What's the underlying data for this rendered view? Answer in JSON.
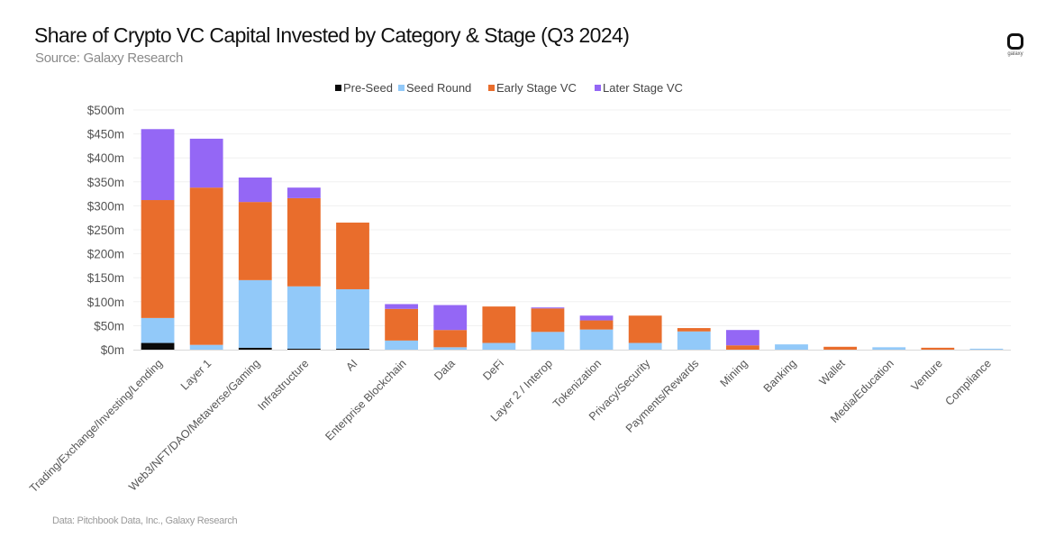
{
  "header": {
    "title": "Share of Crypto VC Capital Invested by Category & Stage (Q3 2024)",
    "subtitle": "Source: Galaxy Research",
    "logo_text": "galaxy",
    "logo_icon": "galaxy-logo-icon"
  },
  "footer": {
    "source_note": "Data: Pitchbook Data, Inc., Galaxy Research"
  },
  "chart_data": {
    "type": "bar",
    "stacked": true,
    "title": "Share of Crypto VC Capital Invested by Category & Stage (Q3 2024)",
    "xlabel": "",
    "ylabel": "",
    "ylim": [
      0,
      500
    ],
    "yticks": [
      0,
      50,
      100,
      150,
      200,
      250,
      300,
      350,
      400,
      450,
      500
    ],
    "ytick_labels": [
      "$0m",
      "$50m",
      "$100m",
      "$150m",
      "$200m",
      "$250m",
      "$300m",
      "$350m",
      "$400m",
      "$450m",
      "$500m"
    ],
    "grid": true,
    "legend_position": "top-center",
    "categories": [
      "Trading/Exchange/Investing/Lending",
      "Layer 1",
      "Web3/NFT/DAO/Metaverse/Gaming",
      "Infrastructure",
      "AI",
      "Enterprise Blockchain",
      "Data",
      "DeFi",
      "Layer 2 / Interop",
      "Tokenization",
      "Privacy/Security",
      "Payments/Rewards",
      "Mining",
      "Banking",
      "Wallet",
      "Media/Education",
      "Venture",
      "Compliance"
    ],
    "series": [
      {
        "name": "Pre-Seed",
        "color": "#0a0a0a",
        "values": [
          14,
          0,
          4,
          2,
          2,
          0,
          0,
          0,
          0,
          0,
          0,
          0,
          0,
          0,
          0,
          0,
          0,
          0
        ]
      },
      {
        "name": "Seed Round",
        "color": "#92c9f9",
        "values": [
          52,
          10,
          141,
          130,
          124,
          19,
          5,
          14,
          37,
          42,
          14,
          38,
          0,
          11,
          0,
          5,
          0,
          2
        ]
      },
      {
        "name": "Early Stage VC",
        "color": "#e96d2c",
        "values": [
          246,
          328,
          163,
          184,
          139,
          66,
          36,
          76,
          49,
          19,
          57,
          7,
          9,
          0,
          6,
          0,
          4,
          0
        ]
      },
      {
        "name": "Later Stage VC",
        "color": "#9467f5",
        "values": [
          148,
          102,
          51,
          22,
          0,
          10,
          52,
          0,
          2,
          10,
          0,
          0,
          32,
          0,
          0,
          0,
          0,
          0
        ]
      }
    ]
  }
}
